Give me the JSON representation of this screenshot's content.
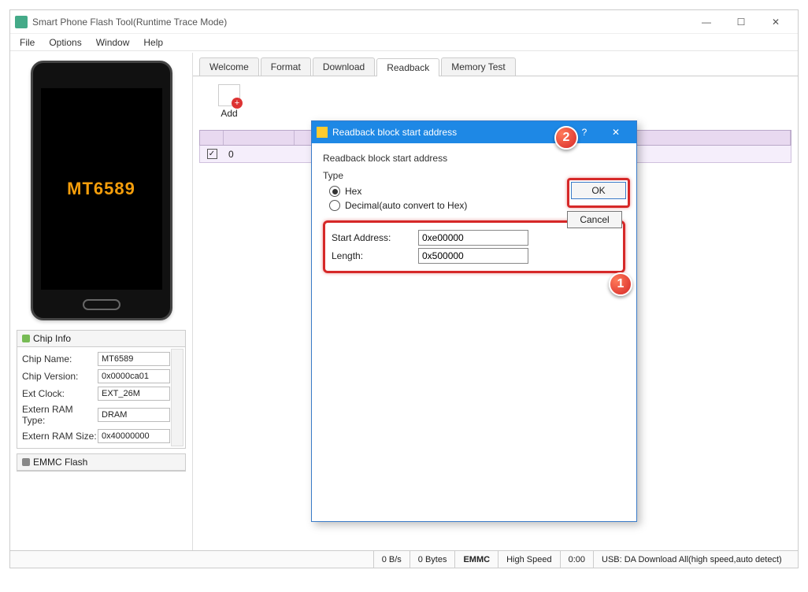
{
  "window": {
    "title": "Smart Phone Flash Tool(Runtime Trace Mode)"
  },
  "menu": {
    "file": "File",
    "options": "Options",
    "window": "Window",
    "help": "Help"
  },
  "tabs": {
    "welcome": "Welcome",
    "format": "Format",
    "download": "Download",
    "readback": "Readback",
    "memtest": "Memory Test"
  },
  "toolbar": {
    "add": "Add"
  },
  "readback_row": {
    "col0": "0"
  },
  "phone": {
    "chip": "MT6589"
  },
  "chipinfo": {
    "title": "Chip Info",
    "rows": {
      "chip_name_l": "Chip Name:",
      "chip_name_v": "MT6589",
      "chip_ver_l": "Chip Version:",
      "chip_ver_v": "0x0000ca01",
      "ext_clock_l": "Ext Clock:",
      "ext_clock_v": "EXT_26M",
      "ram_type_l": "Extern RAM Type:",
      "ram_type_v": "DRAM",
      "ram_size_l": "Extern RAM Size:",
      "ram_size_v": "0x40000000"
    }
  },
  "emmc": {
    "title": "EMMC Flash"
  },
  "dialog": {
    "title": "Readback block start address",
    "heading": "Readback block start address",
    "type_label": "Type",
    "hex": "Hex",
    "decimal": "Decimal(auto convert to Hex)",
    "start_l": "Start Address:",
    "start_v": "0xe00000",
    "len_l": "Length:",
    "len_v": "0x500000",
    "ok": "OK",
    "cancel": "Cancel"
  },
  "callouts": {
    "one": "1",
    "two": "2"
  },
  "status": {
    "rate": "0 B/s",
    "bytes": "0 Bytes",
    "storage": "EMMC",
    "speed": "High Speed",
    "time": "0:00",
    "usb": "USB: DA Download All(high speed,auto detect)"
  }
}
